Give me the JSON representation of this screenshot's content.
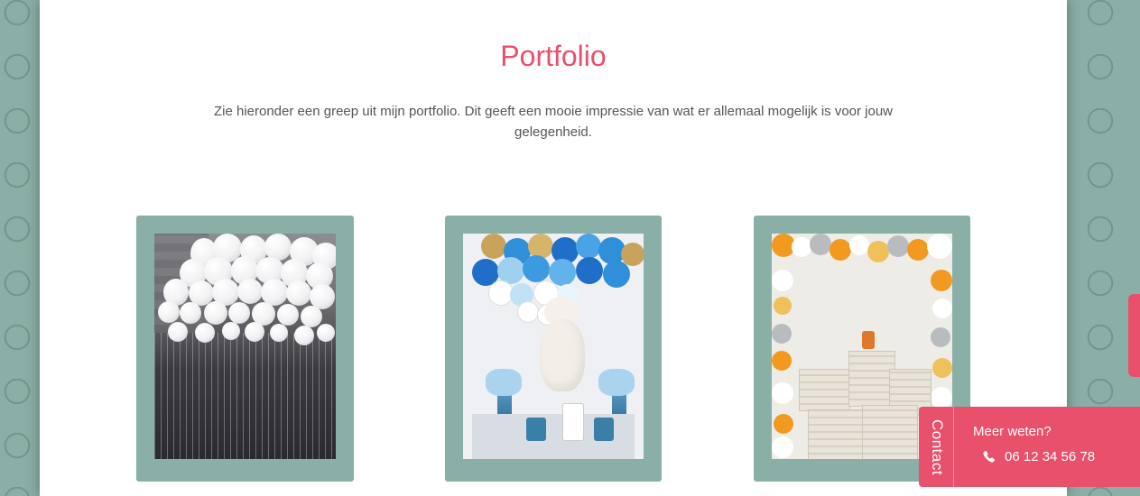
{
  "section": {
    "title": "Portfolio",
    "intro": "Zie hieronder een greep uit mijn portfolio. Dit geeft een mooie impressie van wat er allemaal mogelijk is voor jouw gelegenheid."
  },
  "portfolio": {
    "items": [
      {
        "image": "white-balloons-ceiling-photo"
      },
      {
        "image": "baby-shower-teddy-bear-photo"
      },
      {
        "image": "orange-balloon-arch-crates-photo"
      }
    ]
  },
  "contact_widget": {
    "tab_label": "Contact",
    "question": "Meer weten?",
    "phone": "06 12 34 56 78",
    "phone_icon": "phone-icon"
  },
  "colors": {
    "accent": "#e8506b",
    "card_bg": "#8aafa6",
    "page_bg": "#8aafa6"
  }
}
